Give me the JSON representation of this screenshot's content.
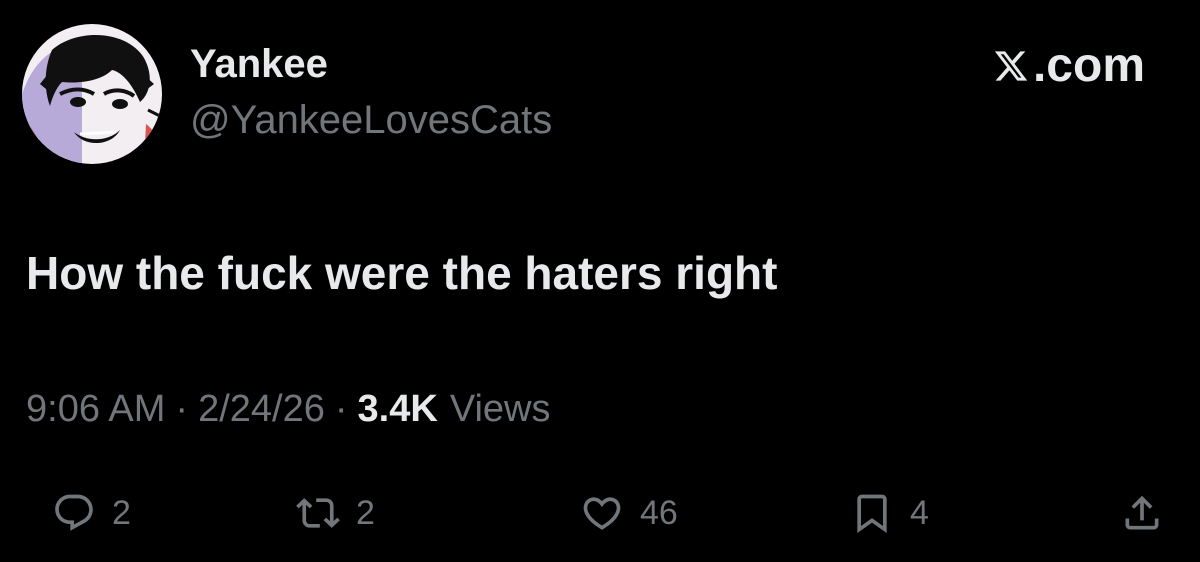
{
  "user": {
    "display_name": "Yankee",
    "handle": "@YankeeLovesCats"
  },
  "brand": {
    "icon": "x-logo-icon",
    "label": ".com"
  },
  "tweet": {
    "text": "How the fuck were the haters right"
  },
  "meta": {
    "time": "9:06 AM",
    "separator": "·",
    "date": "2/24/26",
    "views_count": "3.4K",
    "views_label": "Views"
  },
  "actions": {
    "reply_count": "2",
    "repost_count": "2",
    "like_count": "46",
    "bookmark_count": "4"
  },
  "colors": {
    "background": "#000000",
    "primary_text": "#e7e9ea",
    "secondary_text": "#71767b"
  }
}
